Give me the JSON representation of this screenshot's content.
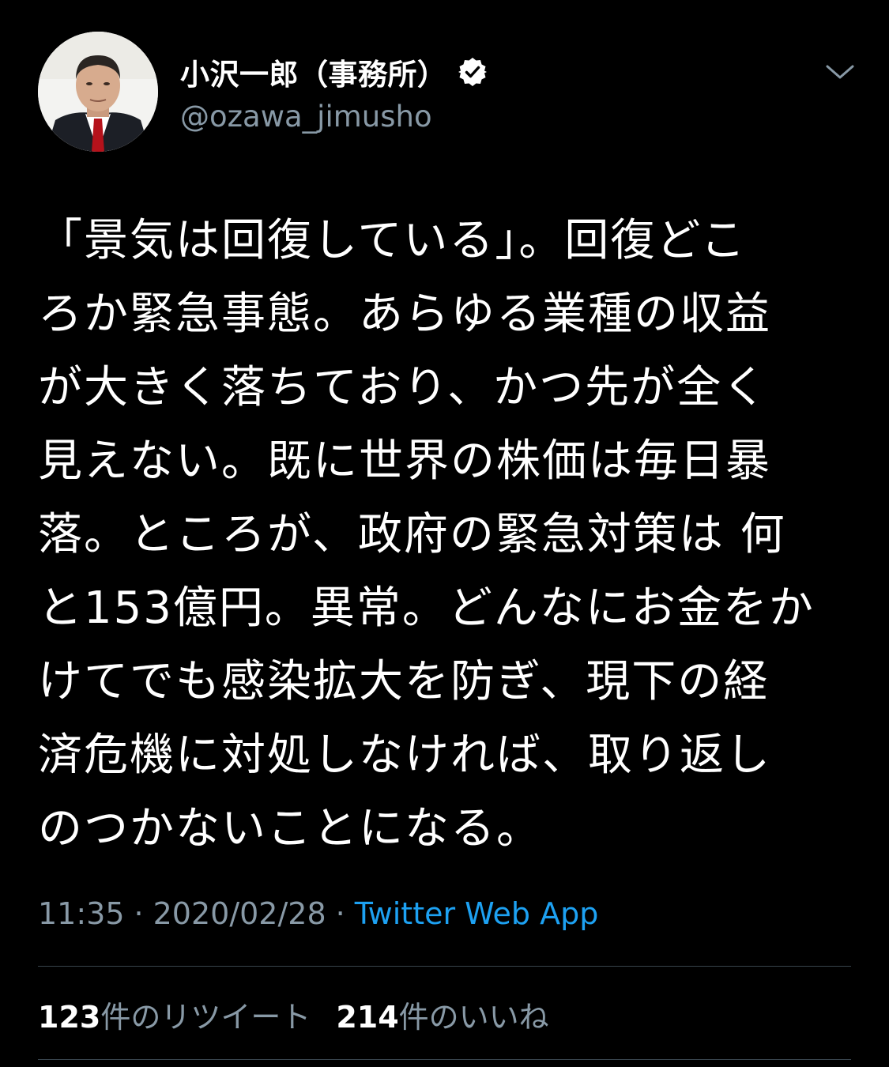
{
  "author": {
    "display_name": "小沢一郎（事務所）",
    "handle": "@ozawa_jimusho",
    "verified_icon": "verified-badge-icon",
    "avatar_icon": "profile-photo"
  },
  "menu_icon": "chevron-down-icon",
  "tweet": {
    "text": "「景気は回復している」。回復どこ\nろか緊急事態。あらゆる業種の収益\nが大きく落ちており、かつ先が全く\n見えない。既に世界の株価は毎日暴\n落。ところが、政府の緊急対策は 何\nと153億円。異常。どんなにお金をか\nけてでも感染拡大を防ぎ、現下の経\n済危機に対処しなければ、取り返し\nのつかないことになる。",
    "time": "11:35",
    "separator": "·",
    "date": "2020/02/28",
    "source": "Twitter Web App"
  },
  "stats": {
    "retweets_count": "123",
    "retweets_label": "件のリツイート",
    "likes_count": "214",
    "likes_label": "件のいいね"
  },
  "colors": {
    "background": "#000000",
    "text": "#ffffff",
    "secondary": "#8899a6",
    "link": "#1da1f2",
    "divider": "#38444d"
  }
}
